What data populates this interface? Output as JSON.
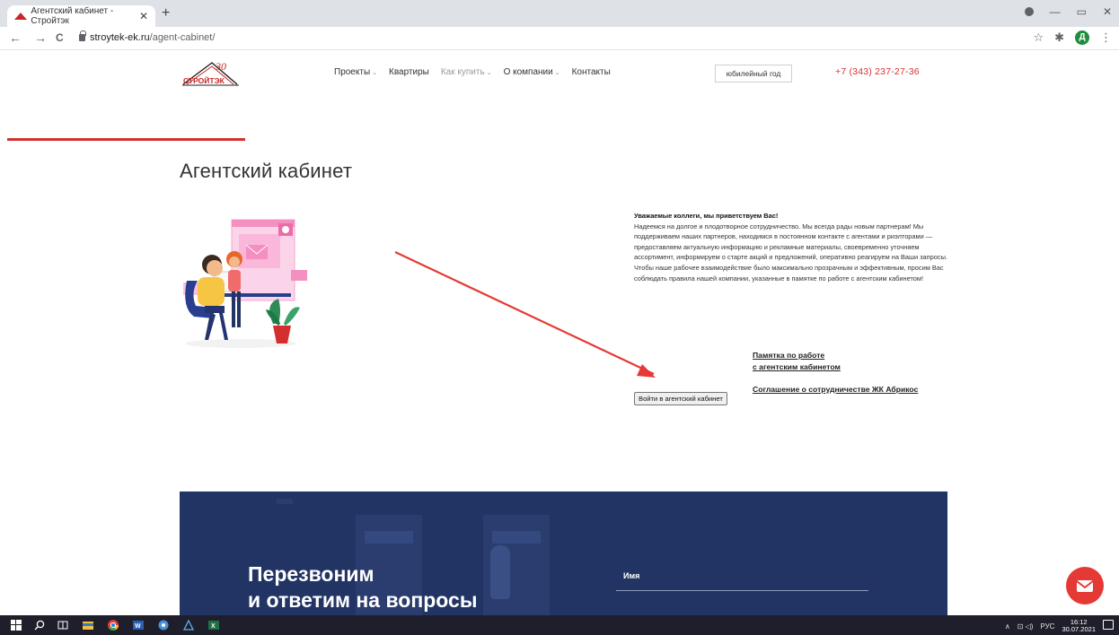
{
  "browser": {
    "tab_title": "Агентский кабинет - Стройтэк",
    "tab_close": "✕",
    "new_tab": "+",
    "url_host": "stroytek-ek.ru",
    "url_path": "/agent-cabinet/",
    "back": "←",
    "forward": "→",
    "reload": "C",
    "star": "☆",
    "extensions": "✱",
    "profile_letter": "Д",
    "menu": "⋮",
    "win_minimize": "—",
    "win_restore": "▭",
    "win_close": "✕"
  },
  "site": {
    "logo_text": "СТРОЙТЭК",
    "logo_anniv": "30",
    "nav": [
      {
        "label": "Проекты",
        "has_dropdown": true,
        "muted": false
      },
      {
        "label": "Квартиры",
        "has_dropdown": false,
        "muted": false
      },
      {
        "label": "Как купить",
        "has_dropdown": true,
        "muted": true
      },
      {
        "label": "О компании",
        "has_dropdown": true,
        "muted": false
      },
      {
        "label": "Контакты",
        "has_dropdown": false,
        "muted": false
      }
    ],
    "anniversary_button": "юбилейный год",
    "phone": "+7 (343) 237-27-36",
    "accent_color": "#d32f2f"
  },
  "page": {
    "title": "Агентский кабинет",
    "intro_heading": "Уважаемые коллеги, мы приветствуем Вас!",
    "intro_body": "Надеемся на долгое и плодотворное сотрудничество. Мы всегда рады новым партнерам! Мы поддерживаем наших партнеров, находимся в постоянном контакте с агентами и риэлторами — предоставляем актуальную информацию и рекламные материалы, своевременно уточняем ассортимент, информируем о старте акций и предложений, оперативно реагируем на Ваши запросы.",
    "intro_body2": "Чтобы наше рабочее взаимодействие было максимально прозрачным и эффективным, просим Вас соблюдать правила нашей компании, указанные в памятке по работе с агентским кабинетом!",
    "link_memo_line1": "Памятка по работе",
    "link_memo_line2": "с агентским кабинетом",
    "link_agreement": "Соглашение о сотрудничестве ЖК Абрикос",
    "login_button": "Войти в агентский кабинет"
  },
  "callback": {
    "title_line1": "Перезвоним",
    "title_line2": "и ответим на вопросы",
    "name_label": "Имя",
    "bg_color": "#223463"
  },
  "taskbar": {
    "lang": "РУС",
    "time": "16:12",
    "date": "30.07.2021",
    "tray_chevron": "∧",
    "tray_icons": "⊡ ◁)"
  }
}
